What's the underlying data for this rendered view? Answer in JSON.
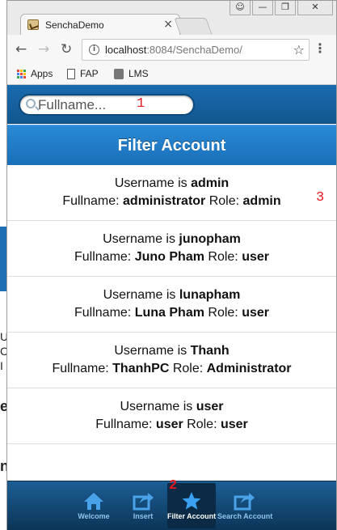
{
  "browser": {
    "tab_title": "SenchaDemo",
    "tab_close": "×",
    "window_buttons": {
      "minimize": "—",
      "restore": "❐",
      "close": "✕"
    },
    "url_host": "localhost",
    "url_rest": ":8084/SenchaDemo/",
    "bookmarks": [
      {
        "label": "Apps"
      },
      {
        "label": "FAP"
      },
      {
        "label": "LMS"
      }
    ]
  },
  "left_background_text": [
    "U",
    "C",
    "I",
    "e",
    "n"
  ],
  "app": {
    "search": {
      "placeholder": "Fullname...",
      "value": ""
    },
    "title": "Filter Account",
    "annotations": {
      "search": "1",
      "tab": "2",
      "list": "3"
    },
    "accounts": [
      {
        "username": "admin",
        "fullname": "administrator",
        "role": "admin"
      },
      {
        "username": "junopham",
        "fullname": "Juno Pham",
        "role": "user"
      },
      {
        "username": "lunapham",
        "fullname": "Luna Pham",
        "role": "user"
      },
      {
        "username": "Thanh",
        "fullname": "ThanhPC",
        "role": "Administrator"
      },
      {
        "username": "user",
        "fullname": "user",
        "role": "user"
      }
    ],
    "labels": {
      "username_prefix": "Username is ",
      "fullname_prefix": "Fullname: ",
      "role_prefix": " Role: "
    },
    "tabs": [
      {
        "label": "Welcome",
        "icon": "home-icon",
        "active": false
      },
      {
        "label": "Insert",
        "icon": "compose-icon",
        "active": false
      },
      {
        "label": "Filter Account",
        "icon": "star-icon",
        "active": true
      },
      {
        "label": "Search Account",
        "icon": "compose-icon",
        "active": false
      }
    ]
  },
  "colors": {
    "toolbar_blue": "#1b6bb0",
    "title_blue": "#2a8ad6",
    "tabbar_dark": "#0c3558",
    "tab_active_text": "#ffffff",
    "tab_inactive_text": "#8fc3ec",
    "annotation_red": "#e0191f"
  }
}
